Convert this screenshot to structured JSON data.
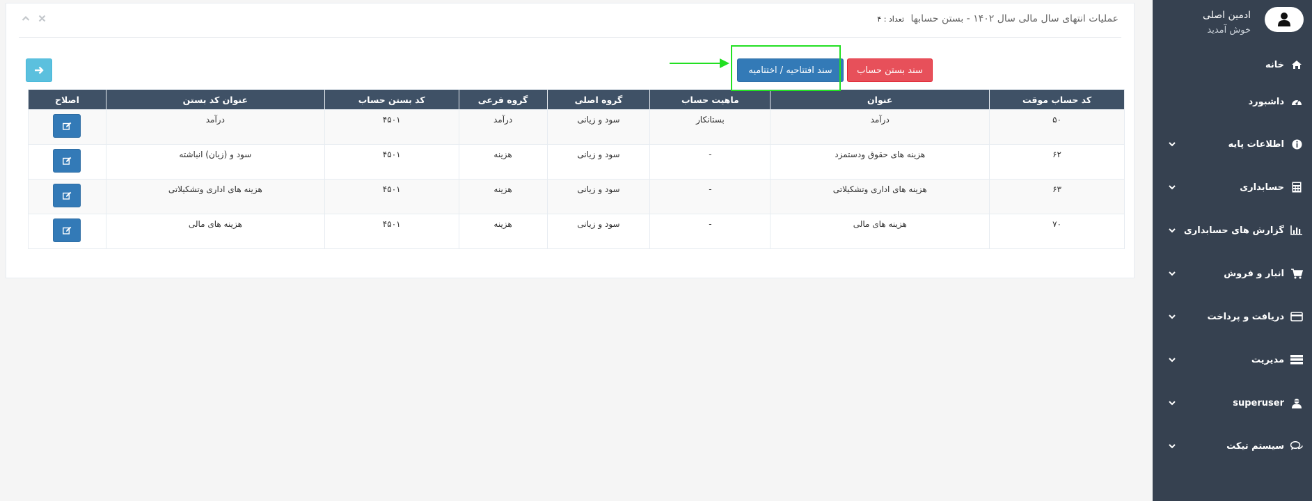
{
  "user": {
    "name": "ادمین اصلی",
    "welcome": "خوش آمدید"
  },
  "sidebar": {
    "items": [
      {
        "label": "خانه",
        "icon": "home-icon",
        "has_submenu": false
      },
      {
        "label": "داشبورد",
        "icon": "dashboard-icon",
        "has_submenu": false
      },
      {
        "label": "اطلاعات پایه",
        "icon": "info-icon",
        "has_submenu": true
      },
      {
        "label": "حسابداری",
        "icon": "calculator-icon",
        "has_submenu": true
      },
      {
        "label": "گزارش های حسابداری",
        "icon": "bar-chart-icon",
        "has_submenu": true
      },
      {
        "label": "انبار و فروش",
        "icon": "cart-icon",
        "has_submenu": true
      },
      {
        "label": "دریافت و پرداخت",
        "icon": "credit-card-icon",
        "has_submenu": true
      },
      {
        "label": "مدیریت",
        "icon": "server-icon",
        "has_submenu": true
      },
      {
        "label": "superuser",
        "icon": "user-secret-icon",
        "has_submenu": true
      },
      {
        "label": "سیستم تیکت",
        "icon": "comments-icon",
        "has_submenu": true
      }
    ]
  },
  "panel": {
    "title": "عملیات انتهای سال مالی سال ۱۴۰۲ - بستن حسابها",
    "count": "تعداد : ۴"
  },
  "actions": {
    "close_account_doc": "سند بستن حساب",
    "opening_closing_doc": "سند افتتاحیه / اختتامیه"
  },
  "table": {
    "headers": [
      "کد حساب موقت",
      "عنوان",
      "ماهیت حساب",
      "گروه اصلی",
      "گروه فرعی",
      "کد بستن حساب",
      "عنوان کد بستن",
      "اصلاح"
    ],
    "rows": [
      [
        "۵۰",
        "درآمد",
        "بستانکار",
        "سود و زیانی",
        "درآمد",
        "۴۵۰۱",
        "درآمد"
      ],
      [
        "۶۲",
        "هزینه های حقوق ودستمزد",
        "-",
        "سود و زیانی",
        "هزینه",
        "۴۵۰۱",
        "سود و (زیان) انباشته"
      ],
      [
        "۶۳",
        "هزینه های اداری وتشکیلاتی",
        "-",
        "سود و زیانی",
        "هزینه",
        "۴۵۰۱",
        "هزینه های اداری وتشکیلاتی"
      ],
      [
        "۷۰",
        "هزینه های مالی",
        "-",
        "سود و زیانی",
        "هزینه",
        "۴۵۰۱",
        "هزینه های مالی"
      ]
    ]
  },
  "colors": {
    "sidebar_bg": "#364150",
    "table_header_bg": "#3f5166",
    "btn_red": "#e7505a",
    "btn_blue": "#337ab7",
    "btn_cyan": "#5bc0de",
    "highlight_green": "#22e022"
  }
}
